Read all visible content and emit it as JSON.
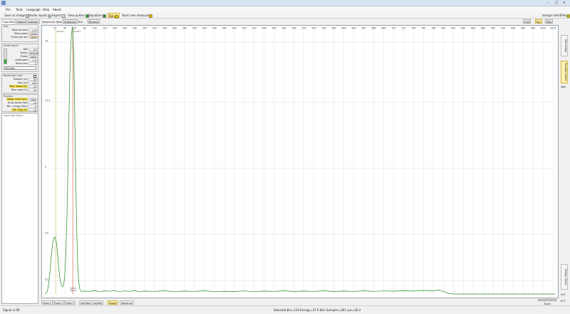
{
  "window": {
    "title": ""
  },
  "menu": [
    "File",
    "Tools",
    "Language",
    "Help",
    "About"
  ],
  "toolbar": {
    "save_image": "Save as image",
    "audio_inputs": "Audio inputs",
    "export": "Export",
    "view_pulses": "View pulses",
    "equalizer": "Equalizer",
    "run": "Run",
    "start_new": "Start new measure",
    "isotope_ident": "Isotope identifier"
  },
  "left_tabs": [
    "Operation",
    "Options",
    "Isotopes"
  ],
  "info": {
    "label": "Info",
    "rows": [
      {
        "k": "Total seconds",
        "v": "(-9)"
      },
      {
        "k": "Total pulses",
        "v": "11058"
      },
      {
        "k": "Pulses per sec",
        "v": "45.0"
      }
    ]
  },
  "audio": {
    "label": "Audio Input",
    "rows": [
      {
        "k": "Bits",
        "v": "24"
      },
      {
        "k": "Samp.",
        "v": "192000"
      },
      {
        "k": "Pulses",
        "v": "8640"
      },
      {
        "k": "Audio gain",
        "v": "1.0"
      },
      {
        "k": "Dead time",
        "v": "0"
      }
    ],
    "device": "Microfon"
  },
  "resolution": {
    "label": "Resolution test",
    "rows": [
      {
        "k": "Position (ch)",
        "v": "56"
      },
      {
        "k": "Size (ch)",
        "v": "200"
      },
      {
        "k": "Max. slope (%)",
        "v": "25"
      },
      {
        "k": "Max noise (%)",
        "v": "20"
      }
    ]
  },
  "params": {
    "label": "Params",
    "rows": [
      {
        "k": "Integr. time (sec)",
        "v": "3000"
      },
      {
        "k": "Draw speed (fps)",
        "v": "10"
      },
      {
        "k": "Min. energy (KeV)",
        "v": "0"
      },
      {
        "k": "Off. Flag (%)",
        "v": "15"
      }
    ]
  },
  "textbox": {
    "placeholder": "Save test items"
  },
  "spectrum": {
    "label": "Spectrum data",
    "autosave": "AutoSave",
    "bins_label": "Bin",
    "browse": "Browse",
    "right_buttons": [
      "Line",
      "Bar",
      "Max"
    ],
    "peak1_label": "Am241",
    "peak2_label": "Am241",
    "peak2_annot": "59.5 %",
    "peak2_annot2": "(Ratio)"
  },
  "right_panel": {
    "btn1": "Max energy",
    "btn2": "Equation detect",
    "btn3": "Energy: linear",
    "num_top": "466",
    "num_bot": "397",
    "zoom_val": "877"
  },
  "bottom_tabs": [
    "Pulse 1",
    "Pulse 2",
    "Pulse 3",
    "Sub Bkg",
    "Log Bkg",
    "Shape",
    "Spectrum"
  ],
  "zoom_label": "Zoom",
  "status": {
    "signal": "Signal is OK",
    "selected": "Selected Bin=124  Energy=37.6 KeV  Samples=281  cps=18.3"
  },
  "chart_data": {
    "type": "line",
    "xlim": [
      0,
      1024
    ],
    "ylim": [
      0,
      20
    ],
    "x_ticks": [
      20,
      40,
      60,
      80,
      100,
      120,
      140,
      160,
      180,
      200,
      220,
      240,
      260,
      280,
      300,
      320,
      340,
      360,
      380,
      400,
      420,
      440,
      460,
      480,
      500,
      520,
      540,
      560,
      580,
      600,
      620,
      640,
      660,
      680,
      700,
      720,
      740,
      760,
      780,
      800,
      820,
      840,
      860,
      880,
      900,
      920,
      940,
      960,
      980,
      1000,
      1020
    ],
    "y_ticks": [
      {
        "v": 19,
        "label": "19"
      },
      {
        "v": 14.5,
        "label": "13.5"
      },
      {
        "v": 9.5,
        "label": "9"
      },
      {
        "v": 4.5,
        "label": "4.5"
      },
      {
        "v": 1,
        "label": "0.5"
      }
    ],
    "markers": [
      {
        "x": 22,
        "color": "#e2d58f"
      },
      {
        "x": 56,
        "color": "#e0786e"
      }
    ],
    "series": [
      {
        "color": "#1e8a1e",
        "points": [
          [
            0,
            0
          ],
          [
            2,
            0.05
          ],
          [
            4,
            0.15
          ],
          [
            6,
            0.4
          ],
          [
            8,
            0.9
          ],
          [
            10,
            1.6
          ],
          [
            12,
            2.5
          ],
          [
            14,
            3.3
          ],
          [
            16,
            3.9
          ],
          [
            18,
            4.25
          ],
          [
            20,
            4.3
          ],
          [
            22,
            4.1
          ],
          [
            24,
            3.6
          ],
          [
            26,
            2.8
          ],
          [
            28,
            1.9
          ],
          [
            30,
            1.2
          ],
          [
            32,
            0.8
          ],
          [
            34,
            0.6
          ],
          [
            36,
            0.55
          ],
          [
            38,
            0.8
          ],
          [
            40,
            1.5
          ],
          [
            42,
            3.0
          ],
          [
            44,
            5.5
          ],
          [
            46,
            9.0
          ],
          [
            48,
            13.0
          ],
          [
            50,
            16.5
          ],
          [
            52,
            19.0
          ],
          [
            54,
            19.8
          ],
          [
            55,
            20.2
          ],
          [
            56,
            19.9
          ],
          [
            58,
            17.5
          ],
          [
            60,
            13.2
          ],
          [
            62,
            8.5
          ],
          [
            64,
            4.6
          ],
          [
            66,
            2.1
          ],
          [
            68,
            0.9
          ],
          [
            70,
            0.4
          ],
          [
            72,
            0.25
          ],
          [
            74,
            0.2
          ],
          [
            80,
            0.22
          ],
          [
            90,
            0.2
          ],
          [
            100,
            0.25
          ],
          [
            110,
            0.18
          ],
          [
            120,
            0.24
          ],
          [
            130,
            0.2
          ],
          [
            140,
            0.26
          ],
          [
            150,
            0.18
          ],
          [
            160,
            0.23
          ],
          [
            170,
            0.2
          ],
          [
            180,
            0.25
          ],
          [
            190,
            0.18
          ],
          [
            200,
            0.22
          ],
          [
            220,
            0.2
          ],
          [
            240,
            0.24
          ],
          [
            260,
            0.18
          ],
          [
            280,
            0.22
          ],
          [
            300,
            0.2
          ],
          [
            320,
            0.24
          ],
          [
            340,
            0.18
          ],
          [
            360,
            0.21
          ],
          [
            380,
            0.19
          ],
          [
            400,
            0.23
          ],
          [
            420,
            0.18
          ],
          [
            440,
            0.22
          ],
          [
            460,
            0.2
          ],
          [
            480,
            0.24
          ],
          [
            500,
            0.19
          ],
          [
            520,
            0.22
          ],
          [
            540,
            0.2
          ],
          [
            560,
            0.24
          ],
          [
            580,
            0.19
          ],
          [
            600,
            0.22
          ],
          [
            620,
            0.2
          ],
          [
            640,
            0.24
          ],
          [
            660,
            0.2
          ],
          [
            680,
            0.23
          ],
          [
            700,
            0.21
          ],
          [
            720,
            0.25
          ],
          [
            740,
            0.22
          ],
          [
            760,
            0.27
          ],
          [
            780,
            0.24
          ],
          [
            790,
            0.3
          ],
          [
            800,
            0.2
          ],
          [
            810,
            0.05
          ],
          [
            820,
            0
          ],
          [
            1024,
            0
          ]
        ]
      }
    ]
  }
}
